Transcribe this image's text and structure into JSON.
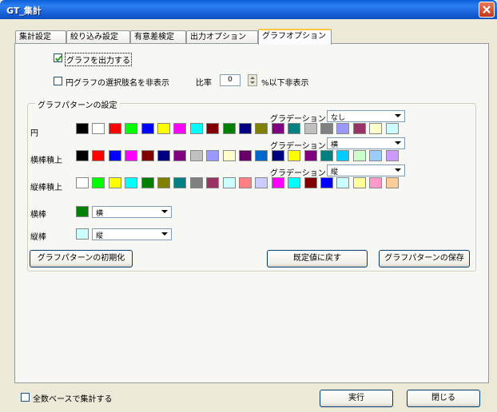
{
  "window": {
    "title": "GT_集計"
  },
  "tabs": [
    "集計設定",
    "絞り込み設定",
    "有意差検定",
    "出力オプション",
    "グラフオプション"
  ],
  "active_tab": 4,
  "options": {
    "output_graph": {
      "label": "グラフを出力する",
      "checked": true
    },
    "hide_pie_labels": {
      "label": "円グラフの選択肢名を非表示",
      "checked": false
    },
    "ratio_label": "比率",
    "ratio_value": "0",
    "ratio_suffix": "%以下非表示"
  },
  "group": {
    "title": "グラフパターンの設定",
    "gradation_label": "グラデーション",
    "rows": [
      {
        "label": "円",
        "gradation": "なし",
        "colors": [
          "#000000",
          "#ffffff",
          "#ff0000",
          "#00ff00",
          "#0000ff",
          "#ffff00",
          "#ff00ff",
          "#00ffff",
          "#800000",
          "#008000",
          "#000080",
          "#808000",
          "#800080",
          "#008080",
          "#c0c0c0",
          "#808080",
          "#9999ff",
          "#993366",
          "#ffffcc",
          "#ccffff"
        ]
      },
      {
        "label": "横棒積上",
        "gradation": "横",
        "colors": [
          "#000000",
          "#ff0000",
          "#0000ff",
          "#ff00ff",
          "#800000",
          "#000080",
          "#800080",
          "#c0c0c0",
          "#9999ff",
          "#ffffcc",
          "#660066",
          "#0066cc",
          "#000080",
          "#ffff00",
          "#800080",
          "#008080",
          "#00ccff",
          "#ccffcc",
          "#99ccff",
          "#cc99ff"
        ]
      },
      {
        "label": "縦棒積上",
        "gradation": "縦",
        "colors": [
          "#ffffff",
          "#00ff00",
          "#ffff00",
          "#00ffff",
          "#008000",
          "#808000",
          "#008080",
          "#808080",
          "#993366",
          "#ccffff",
          "#ff8080",
          "#ccccff",
          "#ff00ff",
          "#00ffff",
          "#800000",
          "#0000ff",
          "#ccffff",
          "#ffff99",
          "#ff99cc",
          "#ffcc99"
        ]
      }
    ],
    "bar_h": {
      "label": "横棒",
      "color": "#008000",
      "direction": "横"
    },
    "bar_v": {
      "label": "縦棒",
      "color": "#ccffff",
      "direction": "縦"
    },
    "buttons": {
      "reset": "グラフパターンの初期化",
      "default": "既定値に戻す",
      "save": "グラフパターンの保存"
    }
  },
  "footer": {
    "total_base": {
      "label": "全数ベースで集計する",
      "checked": false
    },
    "run": "実行",
    "close": "閉じる"
  },
  "colors": {
    "titlebar": "#0a5fd8",
    "dialog_bg": "#ece9d8",
    "panel_bg": "#f7f7f4"
  }
}
